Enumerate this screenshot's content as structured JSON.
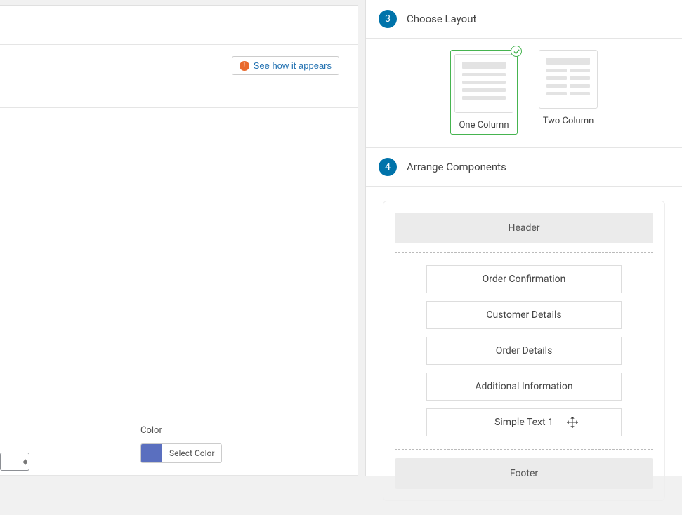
{
  "left": {
    "see_how_label": "See how it appears",
    "color_label": "Color",
    "select_color_label": "Select Color",
    "swatch_color": "#5a6fbf"
  },
  "steps": {
    "layout": {
      "number": "3",
      "title": "Choose Layout"
    },
    "arrange": {
      "number": "4",
      "title": "Arrange Components"
    }
  },
  "layouts": [
    {
      "label": "One Column",
      "selected": true
    },
    {
      "label": "Two Column",
      "selected": false
    }
  ],
  "arrange": {
    "header": "Header",
    "footer": "Footer",
    "components": [
      "Order Confirmation",
      "Customer Details",
      "Order Details",
      "Additional Information",
      "Simple Text 1"
    ]
  }
}
